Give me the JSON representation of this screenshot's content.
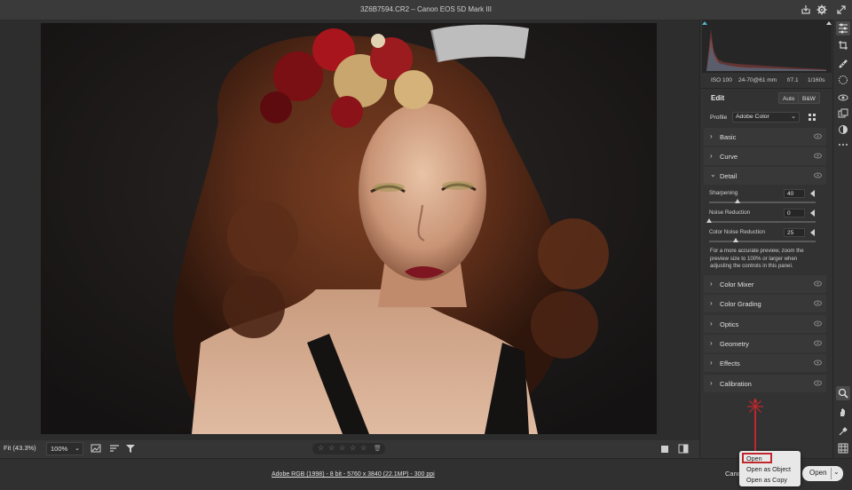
{
  "window": {
    "title": "3Z6B7594.CR2  –  Canon EOS 5D Mark III"
  },
  "camera_info": {
    "iso": "ISO 100",
    "lens": "24-70@61 mm",
    "aperture": "f/7.1",
    "shutter": "1/160s"
  },
  "edit": {
    "title": "Edit",
    "auto_label": "Auto",
    "bw_label": "B&W"
  },
  "profile": {
    "label": "Profile",
    "value": "Adobe Color"
  },
  "sections": {
    "basic": "Basic",
    "curve": "Curve",
    "detail": "Detail",
    "color_mixer": "Color Mixer",
    "color_grading": "Color Grading",
    "optics": "Optics",
    "geometry": "Geometry",
    "effects": "Effects",
    "calibration": "Calibration"
  },
  "detail": {
    "sharpening": {
      "label": "Sharpening",
      "value": "40",
      "fraction": 0.27
    },
    "noise_reduction": {
      "label": "Noise Reduction",
      "value": "0",
      "fraction": 0.0
    },
    "color_noise_reduction": {
      "label": "Color Noise Reduction",
      "value": "25",
      "fraction": 0.25
    },
    "hint": "For a more accurate preview, zoom the preview size to 100% or larger when adjusting the controls in this panel."
  },
  "toolbar": {
    "fit_label": "Fit (43.3%)",
    "zoom_value": "100%"
  },
  "status": {
    "file_info": "Adobe RGB (1998) - 8 bit - 5760 x 3840 (22.1MP) - 300 ppi"
  },
  "actions": {
    "cancel_label": "Canc",
    "open_label": "Open"
  },
  "open_menu": {
    "items": [
      "Open",
      "Open as Object",
      "Open as Copy"
    ]
  },
  "colors": {
    "accent": "#c1272d",
    "panel": "#323232",
    "section": "#383838"
  }
}
